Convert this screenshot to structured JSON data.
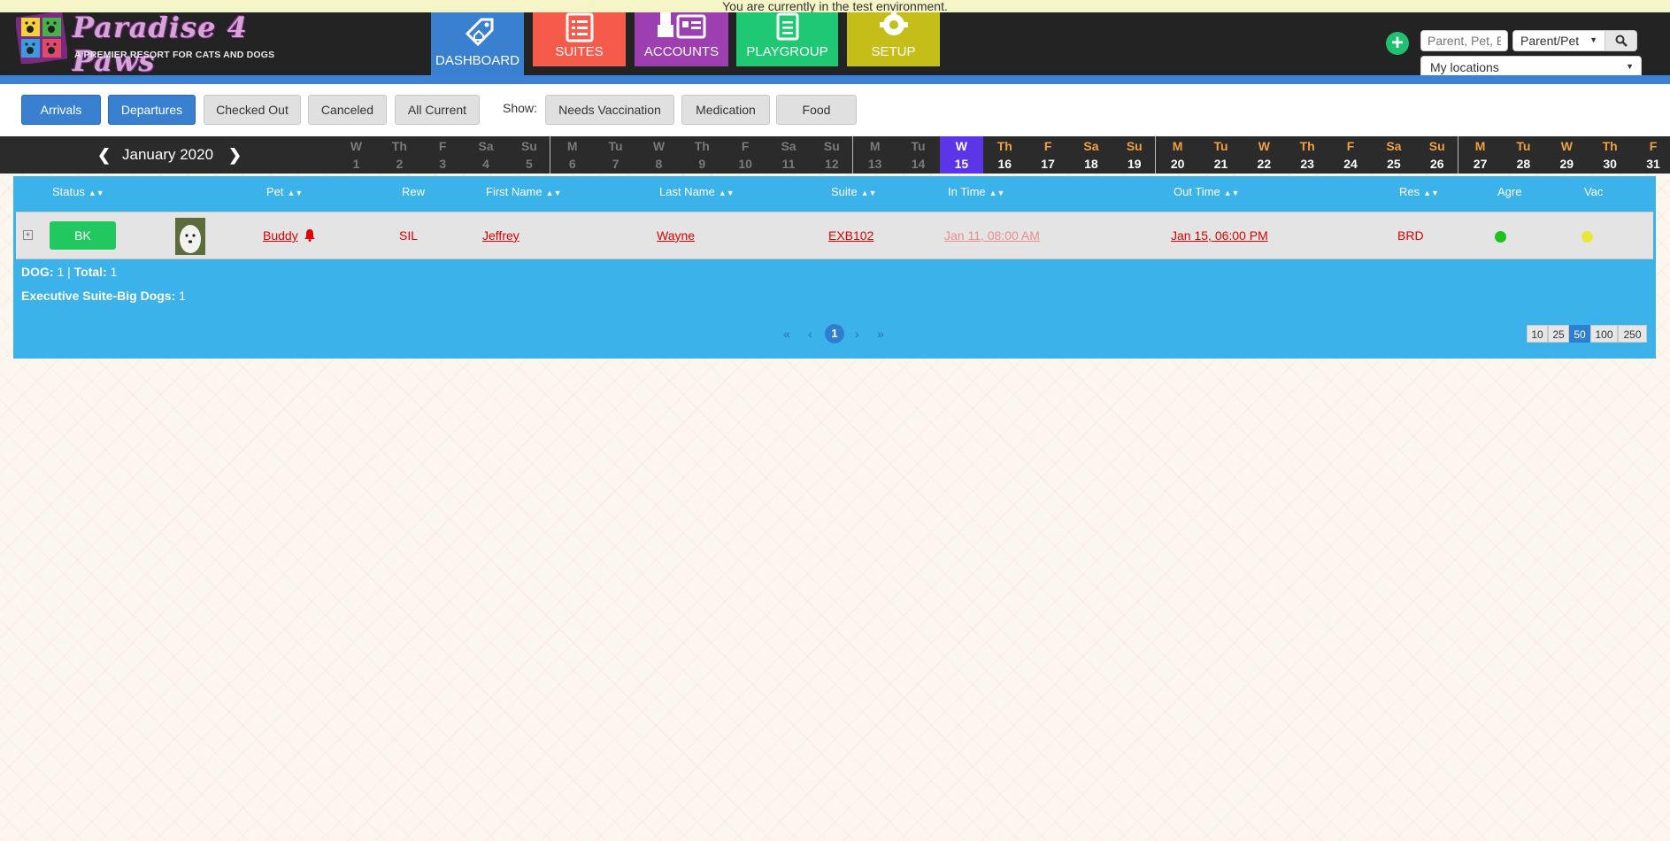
{
  "banner": {
    "text": "You are currently in the test environment."
  },
  "logo": {
    "title": "Paradise 4 Paws",
    "subtitle": "A PREMIER RESORT FOR CATS AND DOGS"
  },
  "nav": {
    "dashboard": "DASHBOARD",
    "suites": "SUITES",
    "accounts": "ACCOUNTS",
    "playgroup": "PLAYGROUP",
    "setup": "SETUP"
  },
  "search": {
    "placeholder": "Parent, Pet, E",
    "type_value": "Parent/Pet",
    "locations_value": "My locations"
  },
  "filters": {
    "arrivals": "Arrivals",
    "departures": "Departures",
    "checked_out": "Checked Out",
    "canceled": "Canceled",
    "all_current": "All Current",
    "show_label": "Show:",
    "needs_vaccination": "Needs Vaccination",
    "medication": "Medication",
    "food": "Food"
  },
  "calendar": {
    "month": "January 2020",
    "today_index": 14,
    "past_until_index": 13,
    "days": [
      {
        "dn": "W",
        "dd": "1"
      },
      {
        "dn": "Th",
        "dd": "2"
      },
      {
        "dn": "F",
        "dd": "3"
      },
      {
        "dn": "Sa",
        "dd": "4"
      },
      {
        "dn": "Su",
        "dd": "5"
      },
      {
        "dn": "M",
        "dd": "6"
      },
      {
        "dn": "Tu",
        "dd": "7"
      },
      {
        "dn": "W",
        "dd": "8"
      },
      {
        "dn": "Th",
        "dd": "9"
      },
      {
        "dn": "F",
        "dd": "10"
      },
      {
        "dn": "Sa",
        "dd": "11"
      },
      {
        "dn": "Su",
        "dd": "12"
      },
      {
        "dn": "M",
        "dd": "13"
      },
      {
        "dn": "Tu",
        "dd": "14"
      },
      {
        "dn": "W",
        "dd": "15"
      },
      {
        "dn": "Th",
        "dd": "16"
      },
      {
        "dn": "F",
        "dd": "17"
      },
      {
        "dn": "Sa",
        "dd": "18"
      },
      {
        "dn": "Su",
        "dd": "19"
      },
      {
        "dn": "M",
        "dd": "20"
      },
      {
        "dn": "Tu",
        "dd": "21"
      },
      {
        "dn": "W",
        "dd": "22"
      },
      {
        "dn": "Th",
        "dd": "23"
      },
      {
        "dn": "F",
        "dd": "24"
      },
      {
        "dn": "Sa",
        "dd": "25"
      },
      {
        "dn": "Su",
        "dd": "26"
      },
      {
        "dn": "M",
        "dd": "27"
      },
      {
        "dn": "Tu",
        "dd": "28"
      },
      {
        "dn": "W",
        "dd": "29"
      },
      {
        "dn": "Th",
        "dd": "30"
      },
      {
        "dn": "F",
        "dd": "31"
      }
    ]
  },
  "table": {
    "headers": {
      "status": "Status",
      "pet": "Pet",
      "rew": "Rew",
      "first_name": "First Name",
      "last_name": "Last Name",
      "suite": "Suite",
      "in_time": "In Time",
      "out_time": "Out Time",
      "res": "Res",
      "agre": "Agre",
      "vac": "Vac"
    },
    "rows": [
      {
        "status": "BK",
        "pet": "Buddy",
        "rew": "SIL",
        "first_name": "Jeffrey",
        "last_name": "Wayne",
        "suite": "EXB102",
        "in_time": "Jan 11, 08:00 AM",
        "out_time": "Jan 15, 06:00 PM",
        "res": "BRD",
        "agre_color": "#1ec21e",
        "vac_color": "#e8e83a"
      }
    ],
    "summary": {
      "dog_label": "DOG:",
      "dog_count": "1",
      "separator": "|",
      "total_label": "Total:",
      "total_count": "1",
      "suite_label": "Executive Suite-Big Dogs:",
      "suite_count": "1"
    },
    "pager": {
      "first": "«",
      "prev": "‹",
      "current": "1",
      "next": "›",
      "last": "»"
    },
    "page_sizes": [
      "10",
      "25",
      "50",
      "100",
      "250"
    ],
    "page_size_active": "50"
  },
  "colors": {
    "accent": "#3a80d1",
    "panel": "#3bb2ea",
    "today": "#5b35e8",
    "link_red": "#e00000",
    "status_green": "#21c860"
  }
}
